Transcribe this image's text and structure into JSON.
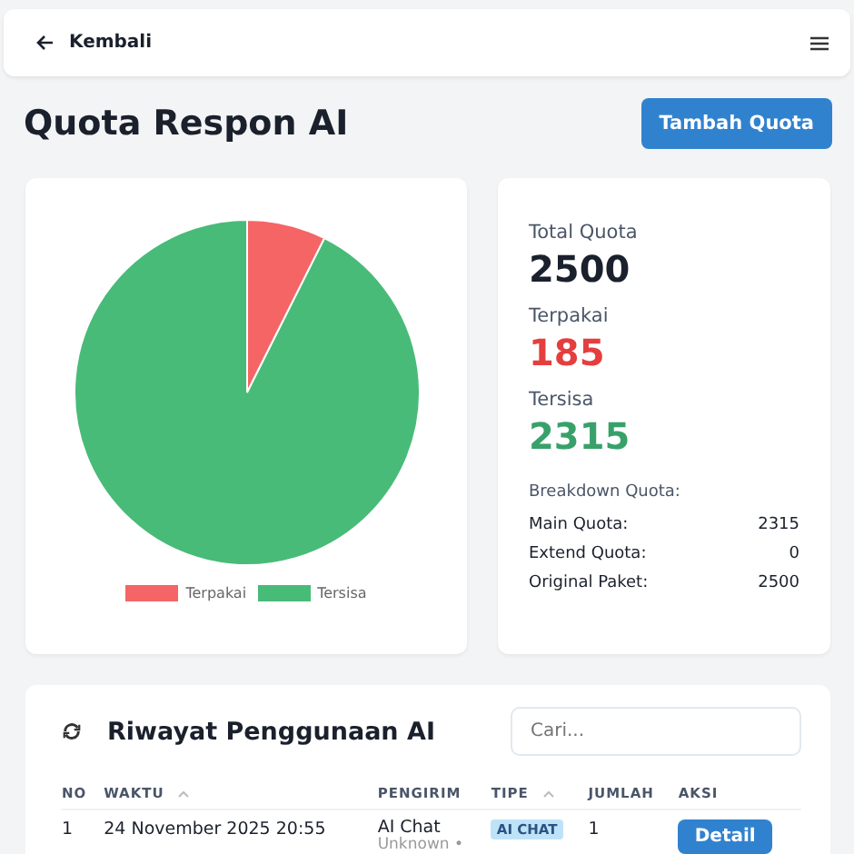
{
  "header": {
    "back_link": "Kembali"
  },
  "page_title": "Quota Respon AI",
  "add_button": "Tambah Quota",
  "chart": {
    "chart_data": {
      "type": "pie",
      "categories": [
        "Terpakai",
        "Tersisa"
      ],
      "values": [
        7.4,
        92.6
      ],
      "colors": [
        "#f56565",
        "#48bb78"
      ]
    }
  },
  "stats": [
    {
      "label": "Total Quota",
      "value": "2500",
      "kind": "total"
    },
    {
      "label": "Terpakai",
      "value": "185",
      "kind": "used"
    },
    {
      "label": "Tersisa",
      "value": "2315",
      "kind": "left"
    }
  ],
  "breakdown": {
    "title": "Breakdown Quota:",
    "rows": [
      {
        "label": "Main Quota:",
        "value": "2315"
      },
      {
        "label": "Extend Quota:",
        "value": "0"
      },
      {
        "label": "Original Paket:",
        "value": "2500"
      }
    ]
  },
  "history": {
    "title": "Riwayat Penggunaan AI",
    "search": {
      "placeholder": "Cari..."
    },
    "columns": [
      {
        "label": "NO",
        "sortable": false
      },
      {
        "label": "WAKTU",
        "sortable": true
      },
      {
        "label": "PENGIRIM",
        "sortable": false
      },
      {
        "label": "TIPE",
        "sortable": true
      },
      {
        "label": "JUMLAH",
        "sortable": false
      },
      {
        "label": "AKSI",
        "sortable": false
      }
    ],
    "rows": [
      {
        "no": "1",
        "time": "24 November 2025 20:55",
        "sender": "AI Chat",
        "sender_sub": "Unknown •",
        "type": "AI CHAT",
        "amount": "1",
        "action": "Detail"
      }
    ]
  }
}
